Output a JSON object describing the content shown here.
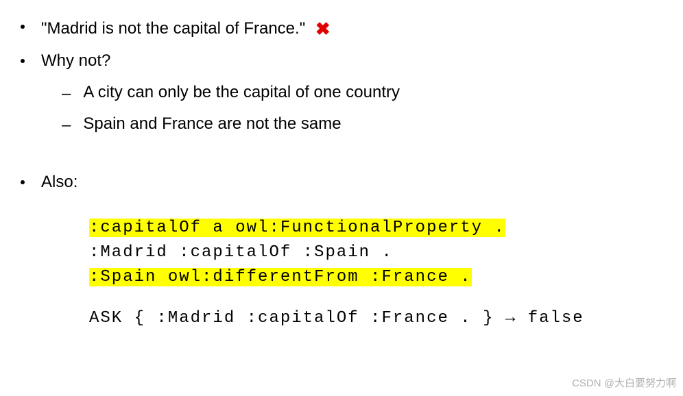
{
  "bullets": {
    "item1": "\"Madrid is not the capital of France.\"",
    "item2": "Why not?",
    "item3": "Also:"
  },
  "sub_items": {
    "sub1": "A city can only be the capital of one country",
    "sub2": "Spain and France are not the same"
  },
  "code": {
    "line1": ":capitalOf a owl:FunctionalProperty .",
    "line2": ":Madrid :capitalOf :Spain .",
    "line3": ":Spain owl:differentFrom :France .",
    "line4": "ASK { :Madrid :capitalOf :France . } → false"
  },
  "watermark": "CSDN @大白要努力啊"
}
